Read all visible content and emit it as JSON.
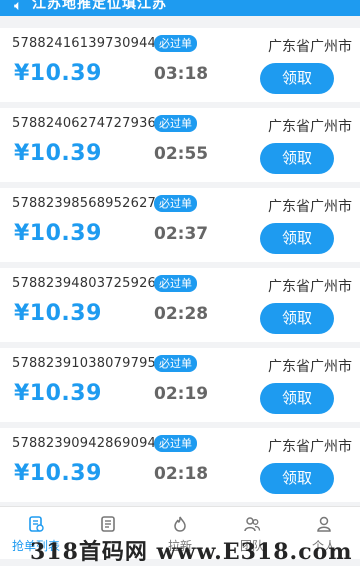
{
  "notice": {
    "text": "江苏地推定位填江苏"
  },
  "orders": [
    {
      "order_no": "578824161397309440",
      "badge": "必过单",
      "city": "广东省广州市",
      "price": "¥10.39",
      "time": "03:18",
      "action": "领取"
    },
    {
      "order_no": "578824062747279360",
      "badge": "必过单",
      "city": "广东省广州市",
      "price": "¥10.39",
      "time": "02:55",
      "action": "领取"
    },
    {
      "order_no": "578823985689526272",
      "badge": "必过单",
      "city": "广东省广州市",
      "price": "¥10.39",
      "time": "02:37",
      "action": "领取"
    },
    {
      "order_no": "578823948037259264",
      "badge": "必过单",
      "city": "广东省广州市",
      "price": "¥10.39",
      "time": "02:28",
      "action": "领取"
    },
    {
      "order_no": "578823910380797952",
      "badge": "必过单",
      "city": "广东省广州市",
      "price": "¥10.39",
      "time": "02:19",
      "action": "领取"
    },
    {
      "order_no": "578823909428690944",
      "badge": "必过单",
      "city": "广东省广州市",
      "price": "¥10.39",
      "time": "02:18",
      "action": "领取"
    }
  ],
  "tabs": [
    {
      "label": "抢单列表",
      "icon": "list-icon",
      "active": true
    },
    {
      "label": "",
      "icon": "document-icon",
      "active": false
    },
    {
      "label": "拉新",
      "icon": "flame-icon",
      "active": false
    },
    {
      "label": "团队",
      "icon": "team-icon",
      "active": false
    },
    {
      "label": "个人",
      "icon": "user-icon",
      "active": false
    }
  ],
  "watermark": {
    "text": "318首码网 www.E318.com"
  },
  "colors": {
    "accent": "#1e9bf0",
    "text": "#333333",
    "muted": "#666666"
  }
}
